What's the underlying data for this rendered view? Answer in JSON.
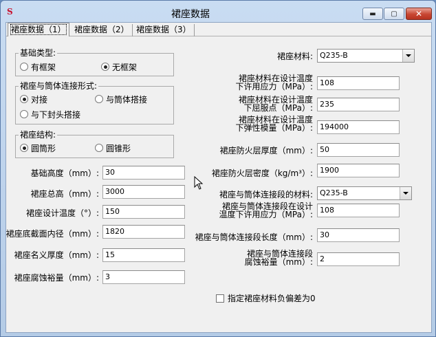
{
  "window": {
    "title": "裙座数据",
    "app_icon_glyph": "S",
    "minimize_glyph": "▬",
    "maximize_glyph": "▢",
    "close_glyph": "✕"
  },
  "tabs": [
    {
      "label": "裙座数据（1）",
      "active": true
    },
    {
      "label": "裙座数据（2）",
      "active": false
    },
    {
      "label": "裙座数据（3）",
      "active": false
    }
  ],
  "base_type": {
    "legend": "基础类型:",
    "options": [
      {
        "label": "有框架",
        "selected": false
      },
      {
        "label": "无框架",
        "selected": true
      }
    ]
  },
  "connection_form": {
    "legend": "裙座与筒体连接形式:",
    "options": [
      {
        "label": "对接",
        "selected": true
      },
      {
        "label": "与筒体搭接",
        "selected": false
      },
      {
        "label": "与下封头搭接",
        "selected": false
      }
    ]
  },
  "skirt_structure": {
    "legend": "裙座结构:",
    "options": [
      {
        "label": "圆筒形",
        "selected": true
      },
      {
        "label": "圆锥形",
        "selected": false
      }
    ]
  },
  "left_fields": [
    {
      "label": "基础高度（mm）:",
      "value": "30"
    },
    {
      "label": "裙座总高（mm）:",
      "value": "3000"
    },
    {
      "label": "裙座设计温度（°）:",
      "value": "150"
    },
    {
      "label": "裙座底截面内径（mm）:",
      "value": "1820"
    },
    {
      "label": "裙座名义厚度（mm）:",
      "value": "15"
    },
    {
      "label": "裙座腐蚀裕量（mm）:",
      "value": "3"
    }
  ],
  "right": {
    "material": {
      "label": "裙座材料:",
      "value": "Q235-B"
    },
    "allow_stress": {
      "line1": "裙座材料在设计温度",
      "line2": "下许用应力（MPa）:",
      "value": "108"
    },
    "yield_point": {
      "line1": "裙座材料在设计温度",
      "line2": "下屈服点（MPa）:",
      "value": "235"
    },
    "elastic_modulus": {
      "line1": "裙座材料在设计温度",
      "line2": "下弹性模量（MPa）:",
      "value": "194000"
    },
    "fireproof_thickness": {
      "label": "裙座防火层厚度（mm）:",
      "value": "50"
    },
    "fireproof_density": {
      "label": "裙座防火层密度（kg/m³）:",
      "value": "1900"
    },
    "conn_material": {
      "label": "裙座与筒体连接段的材料:",
      "value": "Q235-B"
    },
    "conn_allow_stress": {
      "line1": "裙座与筒体连接段在设计",
      "line2": "温度下许用应力（MPa）:",
      "value": "108"
    },
    "conn_length": {
      "label": "裙座与筒体连接段长度（mm）:",
      "value": "30"
    },
    "conn_corrosion": {
      "line1": "裙座与筒体连接段",
      "line2": "腐蚀裕量（mm）:",
      "value": "2"
    }
  },
  "checkbox": {
    "label": "指定裙座材料负偏差为0",
    "checked": false
  }
}
